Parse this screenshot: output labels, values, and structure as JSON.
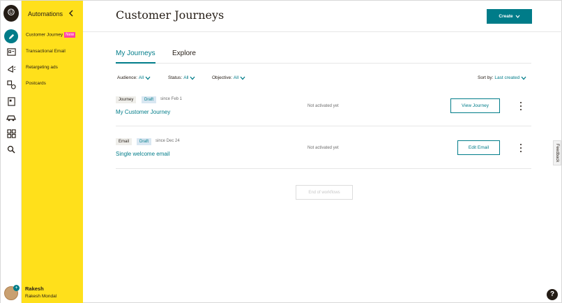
{
  "sidebar": {
    "heading": "Automations",
    "items": [
      {
        "label": "Customer Journey",
        "badge": "New"
      },
      {
        "label": "Transactional Email"
      },
      {
        "label": "Retargeting ads"
      },
      {
        "label": "Postcards"
      }
    ],
    "user": {
      "name": "Rakesh",
      "full_name": "Rakesh Mondal"
    }
  },
  "rail_icons": [
    "pencil-icon",
    "campaigns-icon",
    "megaphone-icon",
    "audience-icon",
    "content-icon",
    "automation-icon",
    "integrations-icon",
    "search-icon"
  ],
  "header": {
    "title": "Customer Journeys",
    "create_label": "Create"
  },
  "tabs": [
    {
      "label": "My Journeys",
      "active": true
    },
    {
      "label": "Explore",
      "active": false
    }
  ],
  "filters": {
    "audience": {
      "label": "Audience:",
      "value": "All"
    },
    "status": {
      "label": "Status:",
      "value": "All"
    },
    "objective": {
      "label": "Objective:",
      "value": "All"
    },
    "sort": {
      "label": "Sort by:",
      "value": "Last created"
    }
  },
  "rows": [
    {
      "type": "Journey",
      "state": "Draft",
      "since": "since Feb 1",
      "name": "My Customer Journey",
      "status": "Not activated yet",
      "action": "View Journey"
    },
    {
      "type": "Email",
      "state": "Draft",
      "since": "since Dec 24",
      "name": "Single welcome email",
      "status": "Not activated yet",
      "action": "Edit Email"
    }
  ],
  "end_label": "End of workflows",
  "feedback_label": "Feedback",
  "help_label": "?",
  "colors": {
    "accent": "#007c89",
    "sidebar": "#ffe01b",
    "badge": "#ff3ea5"
  }
}
